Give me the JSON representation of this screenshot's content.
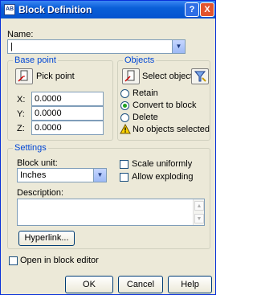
{
  "window": {
    "title": "Block Definition",
    "app_icon": "AB",
    "help_glyph": "?",
    "close_glyph": "X"
  },
  "name": {
    "label": "Name:",
    "value": "|"
  },
  "base_point": {
    "title": "Base point",
    "pick_label": "Pick point",
    "x_label": "X:",
    "x_value": "0.0000",
    "y_label": "Y:",
    "y_value": "0.0000",
    "z_label": "Z:",
    "z_value": "0.0000"
  },
  "objects": {
    "title": "Objects",
    "select_label": "Select objects",
    "options": [
      "Retain",
      "Convert to block",
      "Delete"
    ],
    "selected_option": "Convert to block",
    "warning_text": "No objects selected"
  },
  "settings": {
    "title": "Settings",
    "block_unit_label": "Block unit:",
    "block_unit_value": "Inches",
    "scale_uniformly": "Scale uniformly",
    "allow_exploding": "Allow exploding",
    "description_label": "Description:",
    "hyperlink_label": "Hyperlink..."
  },
  "open_in_editor": "Open in block editor",
  "buttons": {
    "ok": "OK",
    "cancel": "Cancel",
    "help": "Help"
  },
  "colors": {
    "title_bar": "#0553cf",
    "group_title": "#0046d5",
    "dialog_bg": "#ece9d8"
  }
}
